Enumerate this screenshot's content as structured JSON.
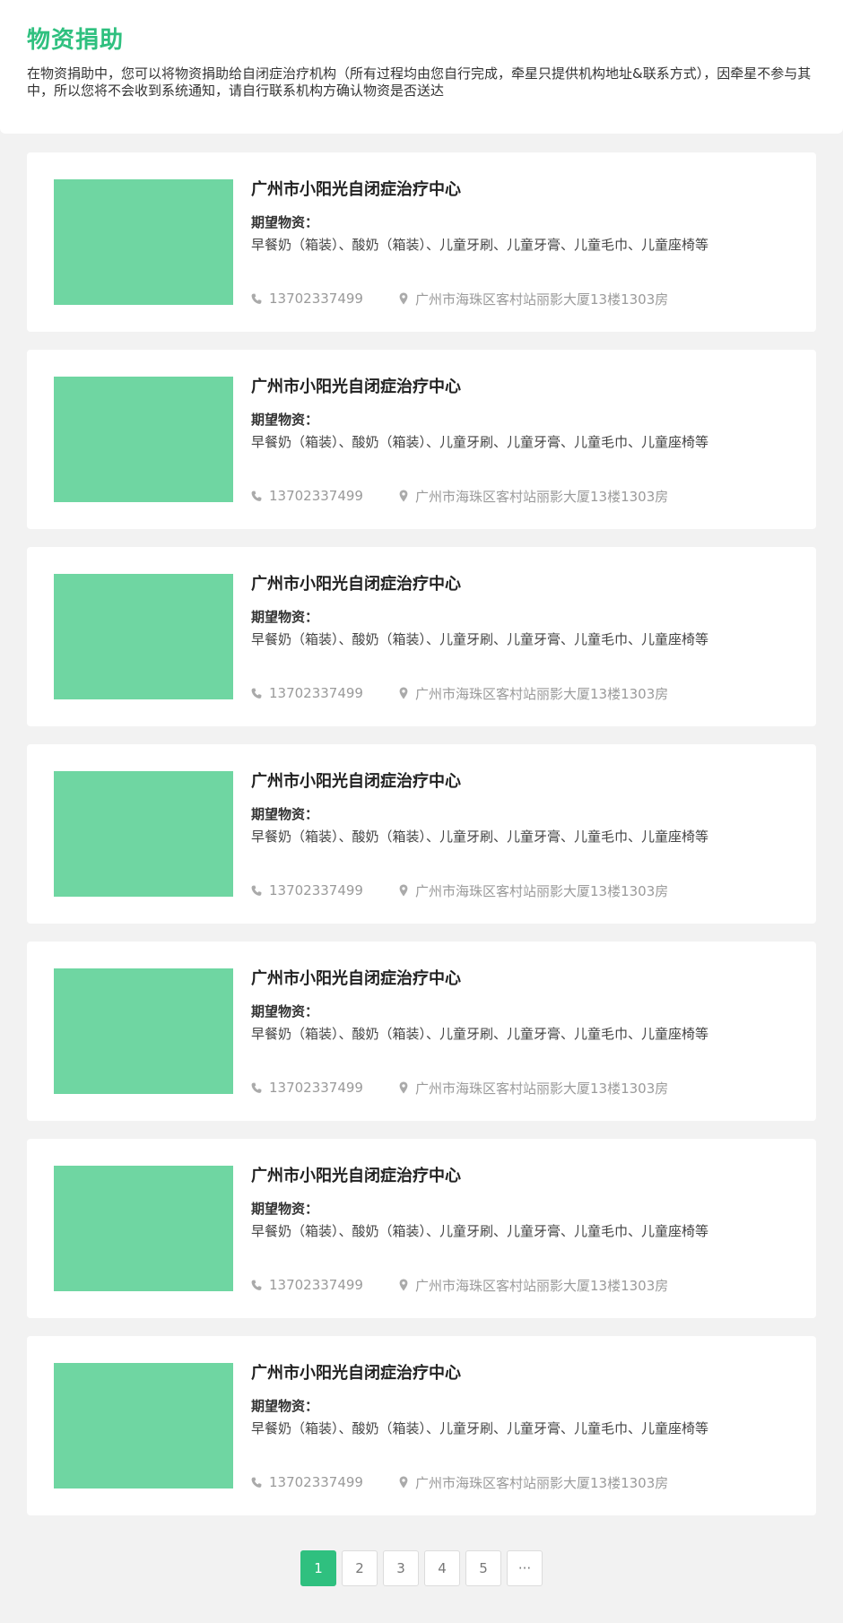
{
  "header": {
    "title": "物资捐助",
    "description": "在物资捐助中，您可以将物资捐助给自闭症治疗机构（所有过程均由您自行完成，牵星只提供机构地址&联系方式），因牵星不参与其中，所以您将不会收到系统通知，请自行联系机构方确认物资是否送达"
  },
  "colors": {
    "accent": "#2fc07f",
    "thumbnail": "#6fd6a2",
    "page_background": "#f2f2f2"
  },
  "cards": [
    {
      "name": "广州市小阳光自闭症治疗中心",
      "needs_label": "期望物资：",
      "needs": "早餐奶（箱装）、酸奶（箱装）、儿童牙刷、儿童牙膏、儿童毛巾、儿童座椅等",
      "phone_icon": "phone-icon",
      "phone": "13702337499",
      "address_icon": "map-pin-icon",
      "address": "广州市海珠区客村站丽影大厦13楼1303房"
    },
    {
      "name": "广州市小阳光自闭症治疗中心",
      "needs_label": "期望物资：",
      "needs": "早餐奶（箱装）、酸奶（箱装）、儿童牙刷、儿童牙膏、儿童毛巾、儿童座椅等",
      "phone_icon": "phone-icon",
      "phone": "13702337499",
      "address_icon": "map-pin-icon",
      "address": "广州市海珠区客村站丽影大厦13楼1303房"
    },
    {
      "name": "广州市小阳光自闭症治疗中心",
      "needs_label": "期望物资：",
      "needs": "早餐奶（箱装）、酸奶（箱装）、儿童牙刷、儿童牙膏、儿童毛巾、儿童座椅等",
      "phone_icon": "phone-icon",
      "phone": "13702337499",
      "address_icon": "map-pin-icon",
      "address": "广州市海珠区客村站丽影大厦13楼1303房"
    },
    {
      "name": "广州市小阳光自闭症治疗中心",
      "needs_label": "期望物资：",
      "needs": "早餐奶（箱装）、酸奶（箱装）、儿童牙刷、儿童牙膏、儿童毛巾、儿童座椅等",
      "phone_icon": "phone-icon",
      "phone": "13702337499",
      "address_icon": "map-pin-icon",
      "address": "广州市海珠区客村站丽影大厦13楼1303房"
    },
    {
      "name": "广州市小阳光自闭症治疗中心",
      "needs_label": "期望物资：",
      "needs": "早餐奶（箱装）、酸奶（箱装）、儿童牙刷、儿童牙膏、儿童毛巾、儿童座椅等",
      "phone_icon": "phone-icon",
      "phone": "13702337499",
      "address_icon": "map-pin-icon",
      "address": "广州市海珠区客村站丽影大厦13楼1303房"
    },
    {
      "name": "广州市小阳光自闭症治疗中心",
      "needs_label": "期望物资：",
      "needs": "早餐奶（箱装）、酸奶（箱装）、儿童牙刷、儿童牙膏、儿童毛巾、儿童座椅等",
      "phone_icon": "phone-icon",
      "phone": "13702337499",
      "address_icon": "map-pin-icon",
      "address": "广州市海珠区客村站丽影大厦13楼1303房"
    },
    {
      "name": "广州市小阳光自闭症治疗中心",
      "needs_label": "期望物资：",
      "needs": "早餐奶（箱装）、酸奶（箱装）、儿童牙刷、儿童牙膏、儿童毛巾、儿童座椅等",
      "phone_icon": "phone-icon",
      "phone": "13702337499",
      "address_icon": "map-pin-icon",
      "address": "广州市海珠区客村站丽影大厦13楼1303房"
    }
  ],
  "pagination": {
    "pages": [
      "1",
      "2",
      "3",
      "4",
      "5",
      "···"
    ],
    "current": "1"
  }
}
